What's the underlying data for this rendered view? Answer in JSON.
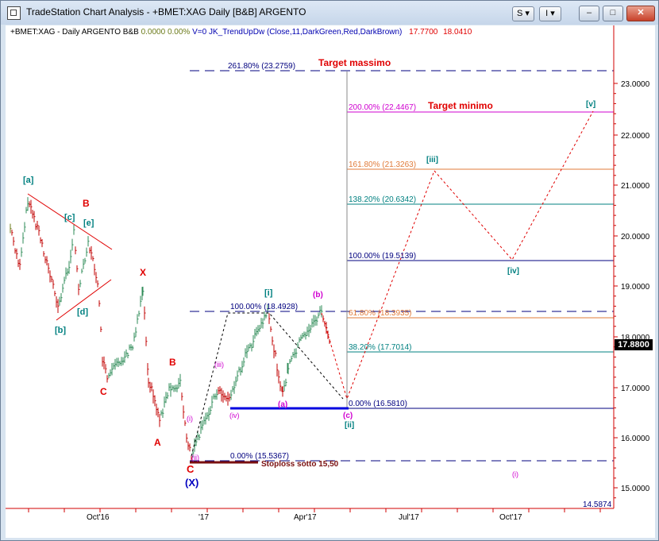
{
  "window": {
    "title": "TradeStation Chart Analysis - +BMET:XAG Daily [B&B] ARGENTO",
    "btn_s_label": "S",
    "btn_i_label": "I",
    "min_label": "–",
    "max_label": "□",
    "close_label": "✕"
  },
  "header": {
    "symbol": "+BMET:XAG - Daily  ARGENTO  B&B",
    "change": "0.0000",
    "change_pct": "0.00%",
    "volume": "V=0",
    "indicator": "JK_TrendUpDw (Close,11,DarkGreen,Red,DarkBrown)",
    "val1": "17.7700",
    "val2": "18.0410"
  },
  "price_axis": {
    "labels": [
      "23.0000",
      "22.0000",
      "21.0000",
      "20.0000",
      "19.0000",
      "18.0000",
      "17.0000",
      "16.0000",
      "15.0000"
    ],
    "last_price": "17.8800",
    "low_label": "14.5874"
  },
  "time_axis": {
    "labels": [
      "Oct'16",
      "'17",
      "Apr'17",
      "Jul'17",
      "Oct'17"
    ]
  },
  "fib_levels": {
    "l2618": "261.80% (23.2759)",
    "l200": "200.00% (22.4467)",
    "l1618": "161.80% (21.3263)",
    "l1382": "138.20% (20.6342)",
    "l100": "100.00% (19.5139)",
    "l618": "61.80% (18.3935)",
    "l382": "38.20% (17.7014)",
    "l0": "0.00% (16.5810)",
    "a100": "100.00% (18.4928)",
    "a0": "0.00% (15.5367)"
  },
  "annotations": {
    "target_max": "Target massimo",
    "target_min": "Target minimo",
    "stoploss": "Stoploss  sotto 15,50"
  },
  "wave_labels": {
    "a_sq": "[a]",
    "b_sq": "[b]",
    "c_sq": "[c]",
    "d_sq": "[d]",
    "e_sq": "[e]",
    "B1": "B",
    "X1": "X",
    "C1": "C",
    "B2": "B",
    "A2": "A",
    "C2": "C",
    "X_par": "(X)",
    "i_small": "(i)",
    "ii_small": "(ii)",
    "iii_small": "(iii)",
    "iv_small": "(iv)",
    "i_sq": "[i]",
    "a_par": "(a)",
    "b_par": "(b)",
    "c_par": "(c)",
    "ii_sq": "[ii]",
    "iii_sq": "[iii]",
    "iv_sq": "[iv]",
    "v_sq": "[v]",
    "i_future": "(i)"
  },
  "colors": {
    "red": "#e00000",
    "teal": "#008080",
    "navy": "#00007f",
    "magenta": "#d000d0",
    "orange": "#e07b39",
    "olive": "#6b7a1a"
  }
}
